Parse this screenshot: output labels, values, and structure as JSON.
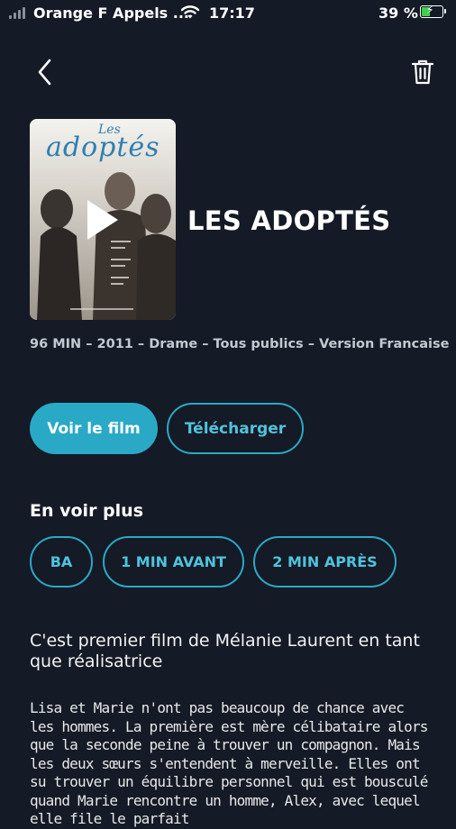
{
  "status_bar": {
    "carrier": "Orange F Appels ...",
    "time": "17:17",
    "battery_percent": "39 %",
    "battery_level": 0.39
  },
  "header": {
    "back_icon": "chevron-left-icon",
    "delete_icon": "trash-icon"
  },
  "movie": {
    "poster_title": "adoptés",
    "poster_small": "Les",
    "title": "LES ADOPTÉS",
    "meta": "96 MIN – 2011 – Drame – Tous publics – Version Francaise"
  },
  "actions": {
    "watch_label": "Voir le film",
    "download_label": "Télécharger"
  },
  "more": {
    "title": "En voir plus",
    "chips": [
      "BA",
      "1 MIN AVANT",
      "2 MIN APRÈS"
    ]
  },
  "description": {
    "tagline": "C'est premier film de Mélanie Laurent en tant que réalisatrice",
    "synopsis": "Lisa et Marie n'ont pas beaucoup de chance avec les hommes. La première est mère célibataire alors que la seconde peine à trouver un compagnon. Mais les deux sœurs s'entendent à merveille. Elles ont su trouver un équilibre personnel qui est bousculé quand Marie rencontre un homme, Alex, avec lequel elle file le parfait"
  },
  "colors": {
    "background": "#141a26",
    "accent": "#2aa9c6"
  }
}
